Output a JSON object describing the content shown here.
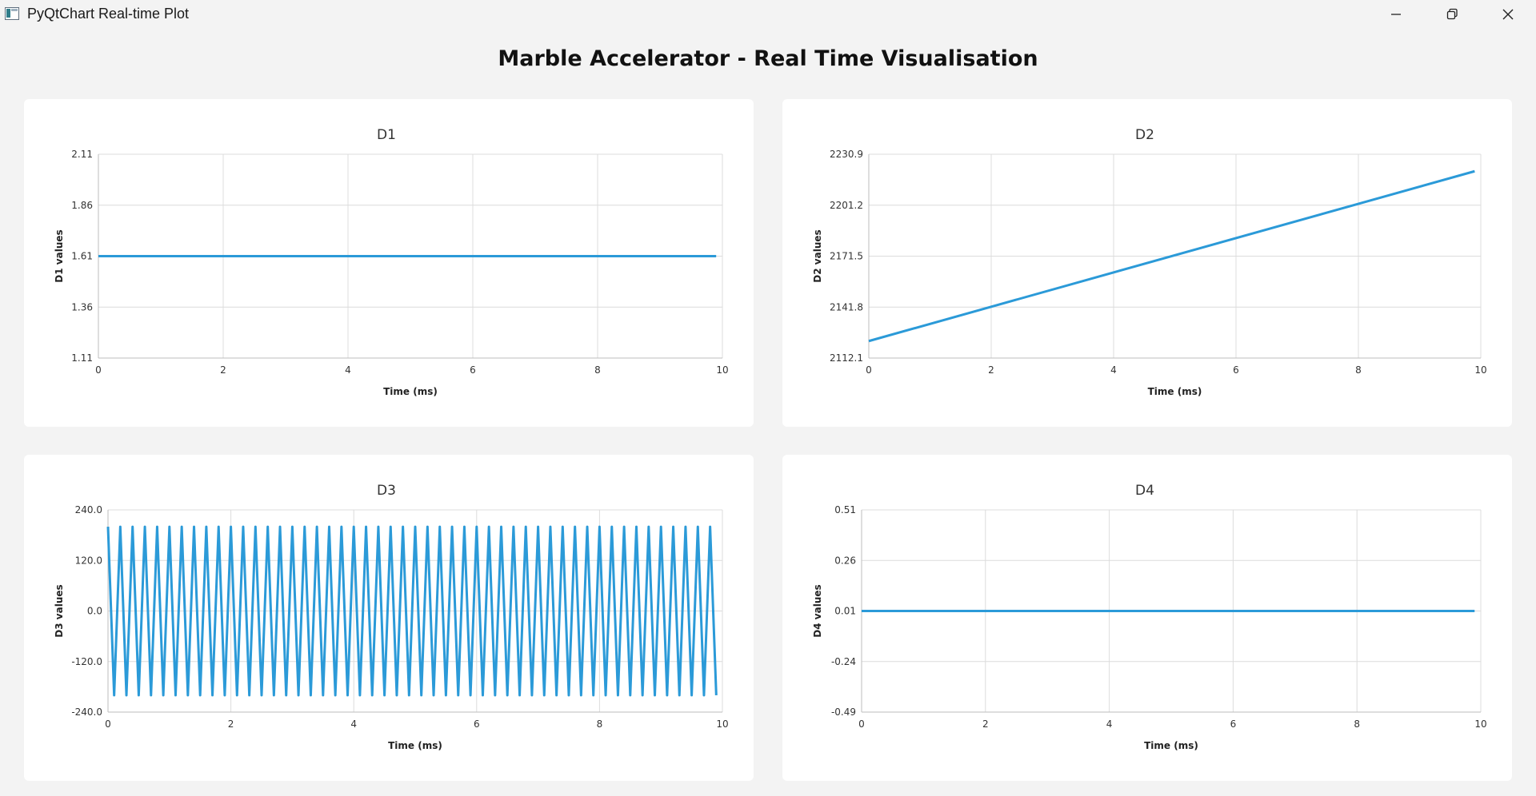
{
  "window": {
    "title": "PyQtChart Real-time Plot",
    "controls": [
      "minimize-icon",
      "restore-icon",
      "close-icon"
    ]
  },
  "heading": "Marble Accelerator - Real Time Visualisation",
  "theme": {
    "series_color": "#2b9ad8",
    "card_bg": "#ffffff",
    "page_bg": "#f3f3f3"
  },
  "chart_data": [
    {
      "type": "line",
      "title": "D1",
      "xlabel": "Time (ms)",
      "ylabel": "D1 values",
      "xlim": [
        0,
        10
      ],
      "ylim": [
        1.11,
        2.11
      ],
      "xticks": [
        "0",
        "2",
        "4",
        "6",
        "8",
        "10"
      ],
      "yticks": [
        "2.11",
        "1.86",
        "1.61",
        "1.36",
        "1.11"
      ],
      "grid": true,
      "series": [
        {
          "x": [
            0,
            9.9
          ],
          "y": [
            1.61,
            1.61
          ]
        }
      ]
    },
    {
      "type": "line",
      "title": "D2",
      "xlabel": "Time (ms)",
      "ylabel": "D2 values",
      "xlim": [
        0,
        10
      ],
      "ylim": [
        2112.1,
        2230.9
      ],
      "xticks": [
        "0",
        "2",
        "4",
        "6",
        "8",
        "10"
      ],
      "yticks": [
        "2230.9",
        "2201.2",
        "2171.5",
        "2141.8",
        "2112.1"
      ],
      "grid": true,
      "series": [
        {
          "x": [
            0,
            9.9
          ],
          "y": [
            2122,
            2221
          ]
        }
      ]
    },
    {
      "type": "line",
      "title": "D3",
      "xlabel": "Time (ms)",
      "ylabel": "D3 values",
      "xlim": [
        0,
        10
      ],
      "ylim": [
        -240,
        240
      ],
      "xticks": [
        "0",
        "2",
        "4",
        "6",
        "8",
        "10"
      ],
      "yticks": [
        "240.0",
        "120.0",
        "0.0",
        "-120.0",
        "-240.0"
      ],
      "grid": true,
      "series": [
        {
          "x_start": 0,
          "x_step": 0.1,
          "y": [
            200,
            -200,
            200,
            -200,
            200,
            -200,
            200,
            -200,
            200,
            -200,
            200,
            -200,
            200,
            -200,
            200,
            -200,
            200,
            -200,
            200,
            -200,
            200,
            -200,
            200,
            -200,
            200,
            -200,
            200,
            -200,
            200,
            -200,
            200,
            -200,
            200,
            -200,
            200,
            -200,
            200,
            -200,
            200,
            -200,
            200,
            -200,
            200,
            -200,
            200,
            -200,
            200,
            -200,
            200,
            -200,
            200,
            -200,
            200,
            -200,
            200,
            -200,
            200,
            -200,
            200,
            -200,
            200,
            -200,
            200,
            -200,
            200,
            -200,
            200,
            -200,
            200,
            -200,
            200,
            -200,
            200,
            -200,
            200,
            -200,
            200,
            -200,
            200,
            -200,
            200,
            -200,
            200,
            -200,
            200,
            -200,
            200,
            -200,
            200,
            -200,
            200,
            -200,
            200,
            -200,
            200,
            -200,
            200,
            -200,
            200,
            -200
          ]
        }
      ]
    },
    {
      "type": "line",
      "title": "D4",
      "xlabel": "Time (ms)",
      "ylabel": "D4 values",
      "xlim": [
        0,
        10
      ],
      "ylim": [
        -0.49,
        0.51
      ],
      "xticks": [
        "0",
        "2",
        "4",
        "6",
        "8",
        "10"
      ],
      "yticks": [
        "0.51",
        "0.26",
        "0.01",
        "-0.24",
        "-0.49"
      ],
      "grid": true,
      "series": [
        {
          "x": [
            0,
            9.9
          ],
          "y": [
            0.01,
            0.01
          ]
        }
      ]
    }
  ]
}
